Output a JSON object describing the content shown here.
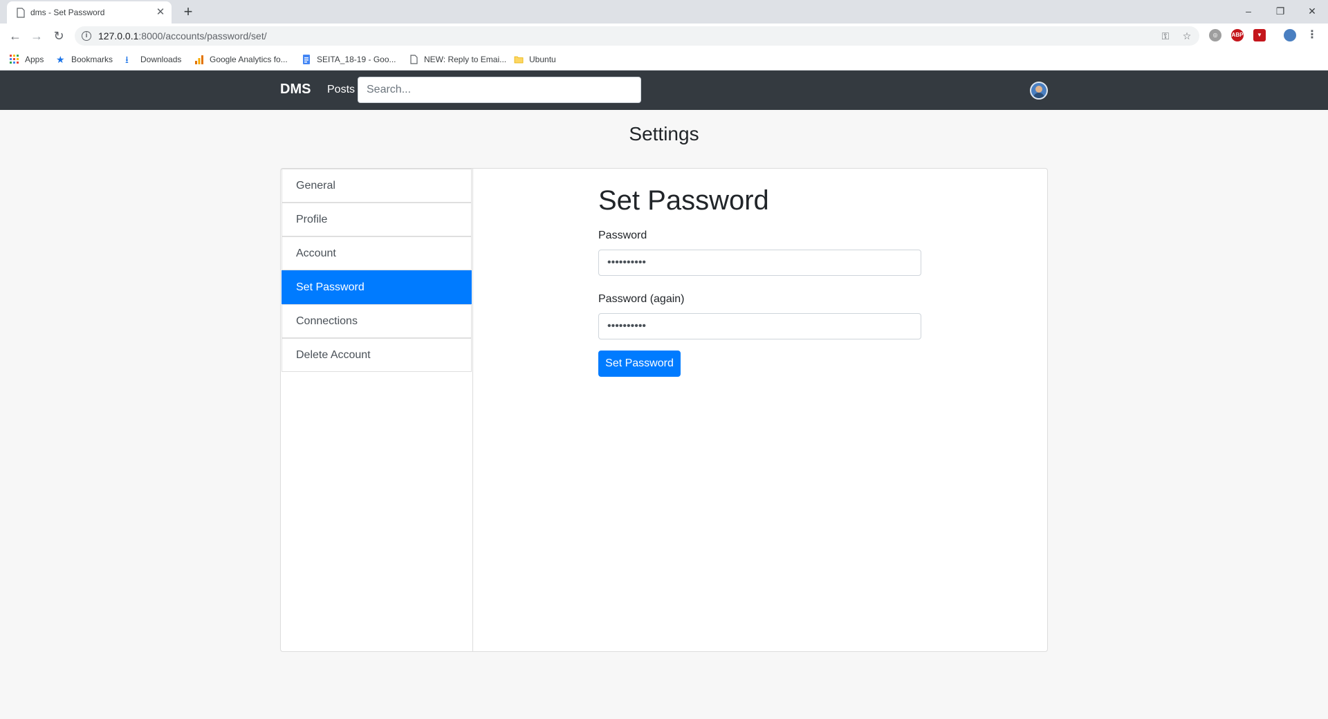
{
  "browser": {
    "tab_title": "dms - Set Password",
    "url_host": "127.0.0.1",
    "url_path": ":8000/accounts/password/set/",
    "bookmarks": [
      {
        "label": "Apps",
        "icon": "apps-grid-icon"
      },
      {
        "label": "Bookmarks",
        "icon": "star-icon"
      },
      {
        "label": "Downloads",
        "icon": "download-icon"
      },
      {
        "label": "Google Analytics fo...",
        "icon": "analytics-icon"
      },
      {
        "label": "SEITA_18-19 - Goo...",
        "icon": "doc-icon"
      },
      {
        "label": "NEW: Reply to Emai...",
        "icon": "page-icon"
      },
      {
        "label": "Ubuntu",
        "icon": "folder-icon"
      }
    ]
  },
  "navbar": {
    "brand": "DMS",
    "posts": "Posts",
    "search_placeholder": "Search..."
  },
  "page": {
    "heading": "Settings"
  },
  "sidebar": {
    "items": [
      {
        "label": "General"
      },
      {
        "label": "Profile"
      },
      {
        "label": "Account"
      },
      {
        "label": "Set Password",
        "active": true
      },
      {
        "label": "Connections"
      },
      {
        "label": "Delete Account"
      }
    ]
  },
  "form": {
    "title": "Set Password",
    "password_label": "Password",
    "password_value": "••••••••••",
    "password_again_label": "Password (again)",
    "password_again_value": "••••••••••",
    "submit_label": "Set Password"
  },
  "colors": {
    "primary": "#007bff",
    "navbar": "#343a40",
    "background": "#f7f7f7"
  }
}
